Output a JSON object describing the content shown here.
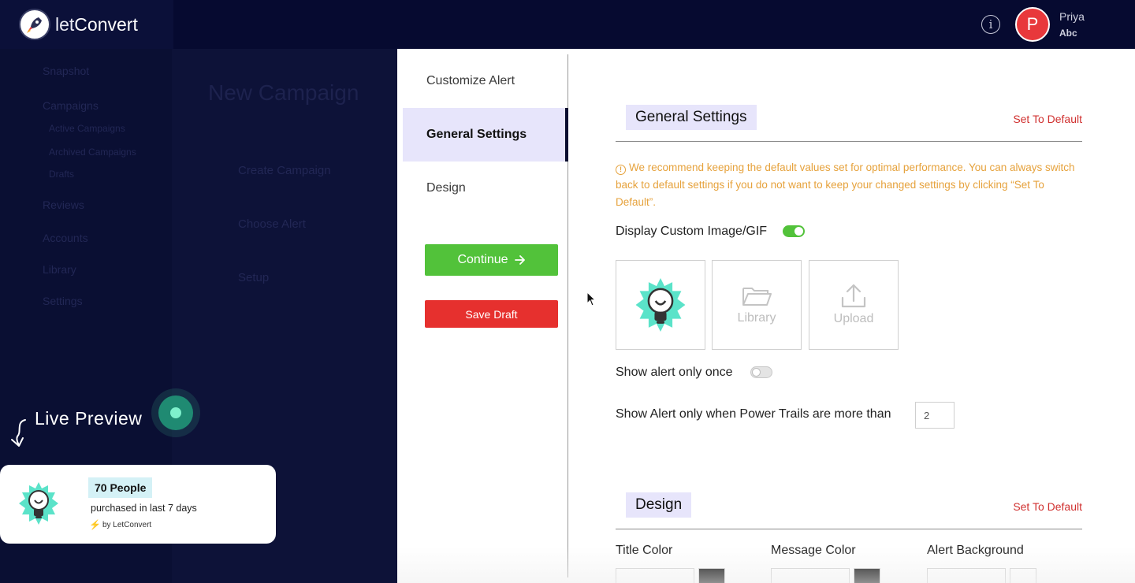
{
  "header": {
    "brand_prefix": "let",
    "brand_suffix": "Convert",
    "user_initial": "P",
    "user_name": "Priya",
    "user_org": "Abc"
  },
  "background": {
    "page_title": "New Campaign",
    "sidebar_items": [
      "Snapshot",
      "Campaigns",
      "Active Campaigns",
      "Archived Campaigns",
      "Drafts",
      "Reviews",
      "Accounts",
      "Library",
      "Settings"
    ],
    "step_labels": [
      "Create Campaign",
      "Choose Alert",
      "Setup"
    ]
  },
  "live_preview": {
    "label": "Live Preview",
    "card_title": "70 People",
    "card_message": "purchased in last 7 days",
    "card_by": "by LetConvert"
  },
  "steps": {
    "items": [
      "Customize Alert",
      "General Settings",
      "Design"
    ],
    "active_index": 1,
    "continue_label": "Continue",
    "save_draft_label": "Save Draft"
  },
  "general_settings": {
    "title": "General Settings",
    "set_default_label": "Set To Default",
    "warning": "We recommend keeping the default values set for optimal performance. You can always switch back to default settings if you do not want to keep your changed settings by clicking “Set To Default”.",
    "display_custom_image_label": "Display Custom Image/GIF",
    "display_custom_image_enabled": true,
    "library_label": "Library",
    "upload_label": "Upload",
    "show_once_label": "Show alert only once",
    "show_once_enabled": false,
    "power_trails_label": "Show Alert only when Power Trails are more than",
    "power_trails_value": "2"
  },
  "design": {
    "title": "Design",
    "set_default_label": "Set To Default",
    "title_color_label": "Title Color",
    "message_color_label": "Message Color",
    "alert_background_label": "Alert Background"
  },
  "colors": {
    "header_bg": "#060a30",
    "accent_green": "#52c23a",
    "danger_red": "#e6302e",
    "warning_orange": "#e6a23c",
    "highlight_lavender": "#e7e5fb",
    "title_color_value": "#000000",
    "message_color_value": "#000000",
    "alert_bg_value": "#ffffff"
  },
  "icons": {
    "info": "info-icon",
    "arrow": "arrow-right-icon",
    "folder": "folder-icon",
    "upload": "upload-icon",
    "bolt": "lightning-icon"
  }
}
